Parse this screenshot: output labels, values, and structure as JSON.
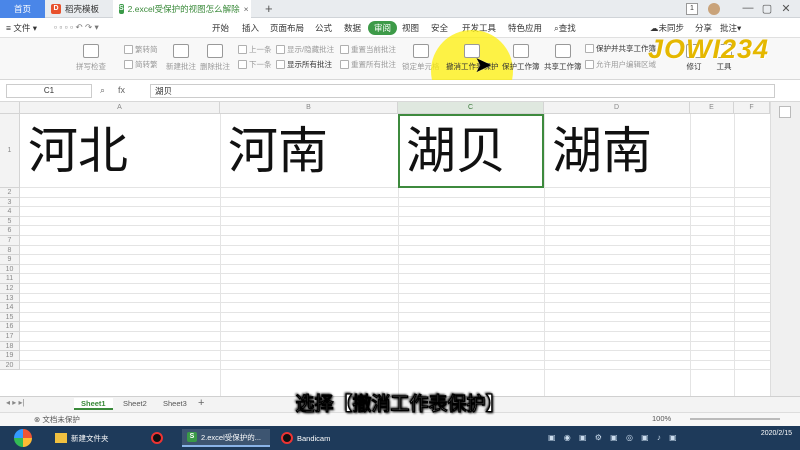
{
  "titlebar": {
    "home_tab": "首页",
    "template_tab": "稻壳模板",
    "doc_tab": "2.excel受保护的视图怎么解除",
    "doc_icon": "S",
    "badge": "1"
  },
  "menu": {
    "file": "文件",
    "items": [
      "开始",
      "插入",
      "页面布局",
      "公式",
      "数据",
      "审阅",
      "视图",
      "安全",
      "开发工具",
      "特色应用"
    ],
    "search": "查找",
    "sync": "未同步",
    "share": "分享",
    "comment": "批注"
  },
  "ribbon": {
    "spell_check": "拼写检查",
    "trad": "繁转简",
    "simp": "简转繁",
    "new_comment": "新建批注",
    "delete_comment": "删除批注",
    "prev": "上一条",
    "next": "下一条",
    "show_hide": "显示/隐藏批注",
    "show_all": "显示所有批注",
    "reset_current": "重置当前批注",
    "reset_all": "重置所有批注",
    "lock_cell": "锁定单元格",
    "unprotect_sheet": "撤消工作表保护",
    "protect_workbook": "保护工作簿",
    "share_workbook": "共享工作簿",
    "protect_share": "保护并共享工作簿",
    "allow_edit": "允许用户编辑区域",
    "track": "修订",
    "tools": "工具"
  },
  "formula_bar": {
    "cell_ref": "C1",
    "fx": "fx",
    "value": "湖贝"
  },
  "grid": {
    "columns": [
      "A",
      "B",
      "C",
      "D",
      "E",
      "F"
    ],
    "rows": [
      "1",
      "2",
      "3",
      "4",
      "5",
      "6",
      "7",
      "8",
      "9",
      "10",
      "11",
      "12",
      "13",
      "14",
      "15",
      "16",
      "17",
      "18",
      "19",
      "20"
    ],
    "cells": [
      "河北",
      "河南",
      "湖贝",
      "湖南"
    ]
  },
  "sheets": [
    "Sheet1",
    "Sheet2",
    "Sheet3"
  ],
  "status": {
    "protect_text": "文档未保护",
    "zoom": "100%"
  },
  "subtitle": "选择【撤消工作表保护】",
  "taskbar": {
    "folder": "新建文件夹",
    "doc": "2.excel受保护的...",
    "bandicam": "Bandicam",
    "date": "2020/2/15"
  },
  "watermark": "JOWI234",
  "colors": {
    "accent": "#3d9a48",
    "highlight": "#fff000",
    "taskbar": "#1e3a5a"
  }
}
